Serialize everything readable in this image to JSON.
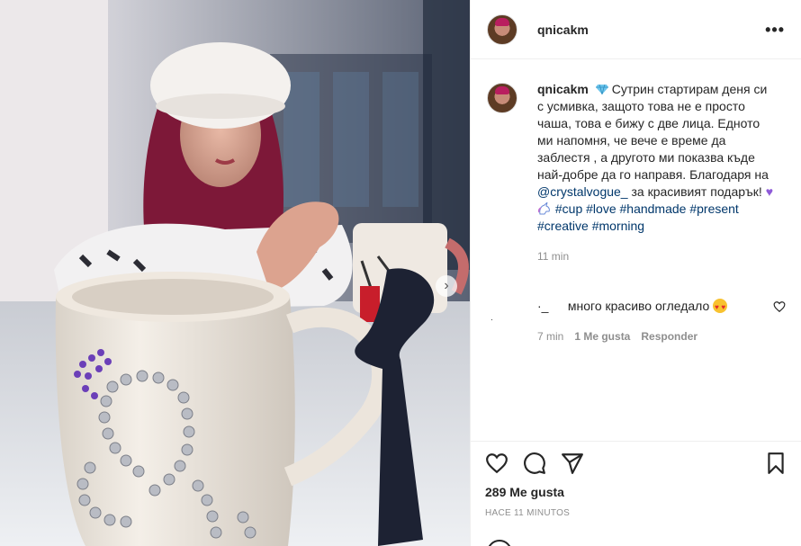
{
  "post": {
    "username": "qnicakm",
    "caption": {
      "username": "qnicakm",
      "text_part1": "Сутрин стартирам деня си с усмивка, защото това не е просто чаша, това е бижу с две лица. Едното ми напомня, че вече е време да заблестя , а другото ми показва къде най-добре да го направя. Благодаря на ",
      "mention": "@crystalvogue_",
      "text_part2": " за красивият подарък! ",
      "hashtags": [
        "#cup",
        "#love",
        "#handmade",
        "#present",
        "#creative",
        "#morning"
      ],
      "time": "11 min"
    },
    "comment": {
      "bullet": "·",
      "username_glyph": "·_",
      "text": "много красиво огледало",
      "time": "7 min",
      "likes": "1 Me gusta",
      "reply": "Responder"
    },
    "likes": "289 Me gusta",
    "timestamp": "HACE 11 MINUTOS",
    "more_icon": "•••"
  },
  "icons": {
    "more": "more-dots-icon",
    "like": "heart-icon",
    "comment": "comment-bubble-icon",
    "share": "paper-plane-icon",
    "save": "bookmark-icon",
    "carousel_next": "chevron-right-icon"
  },
  "colors": {
    "text": "#262626",
    "muted": "#8e8e8e",
    "link": "#00376b",
    "border": "#efefef"
  }
}
